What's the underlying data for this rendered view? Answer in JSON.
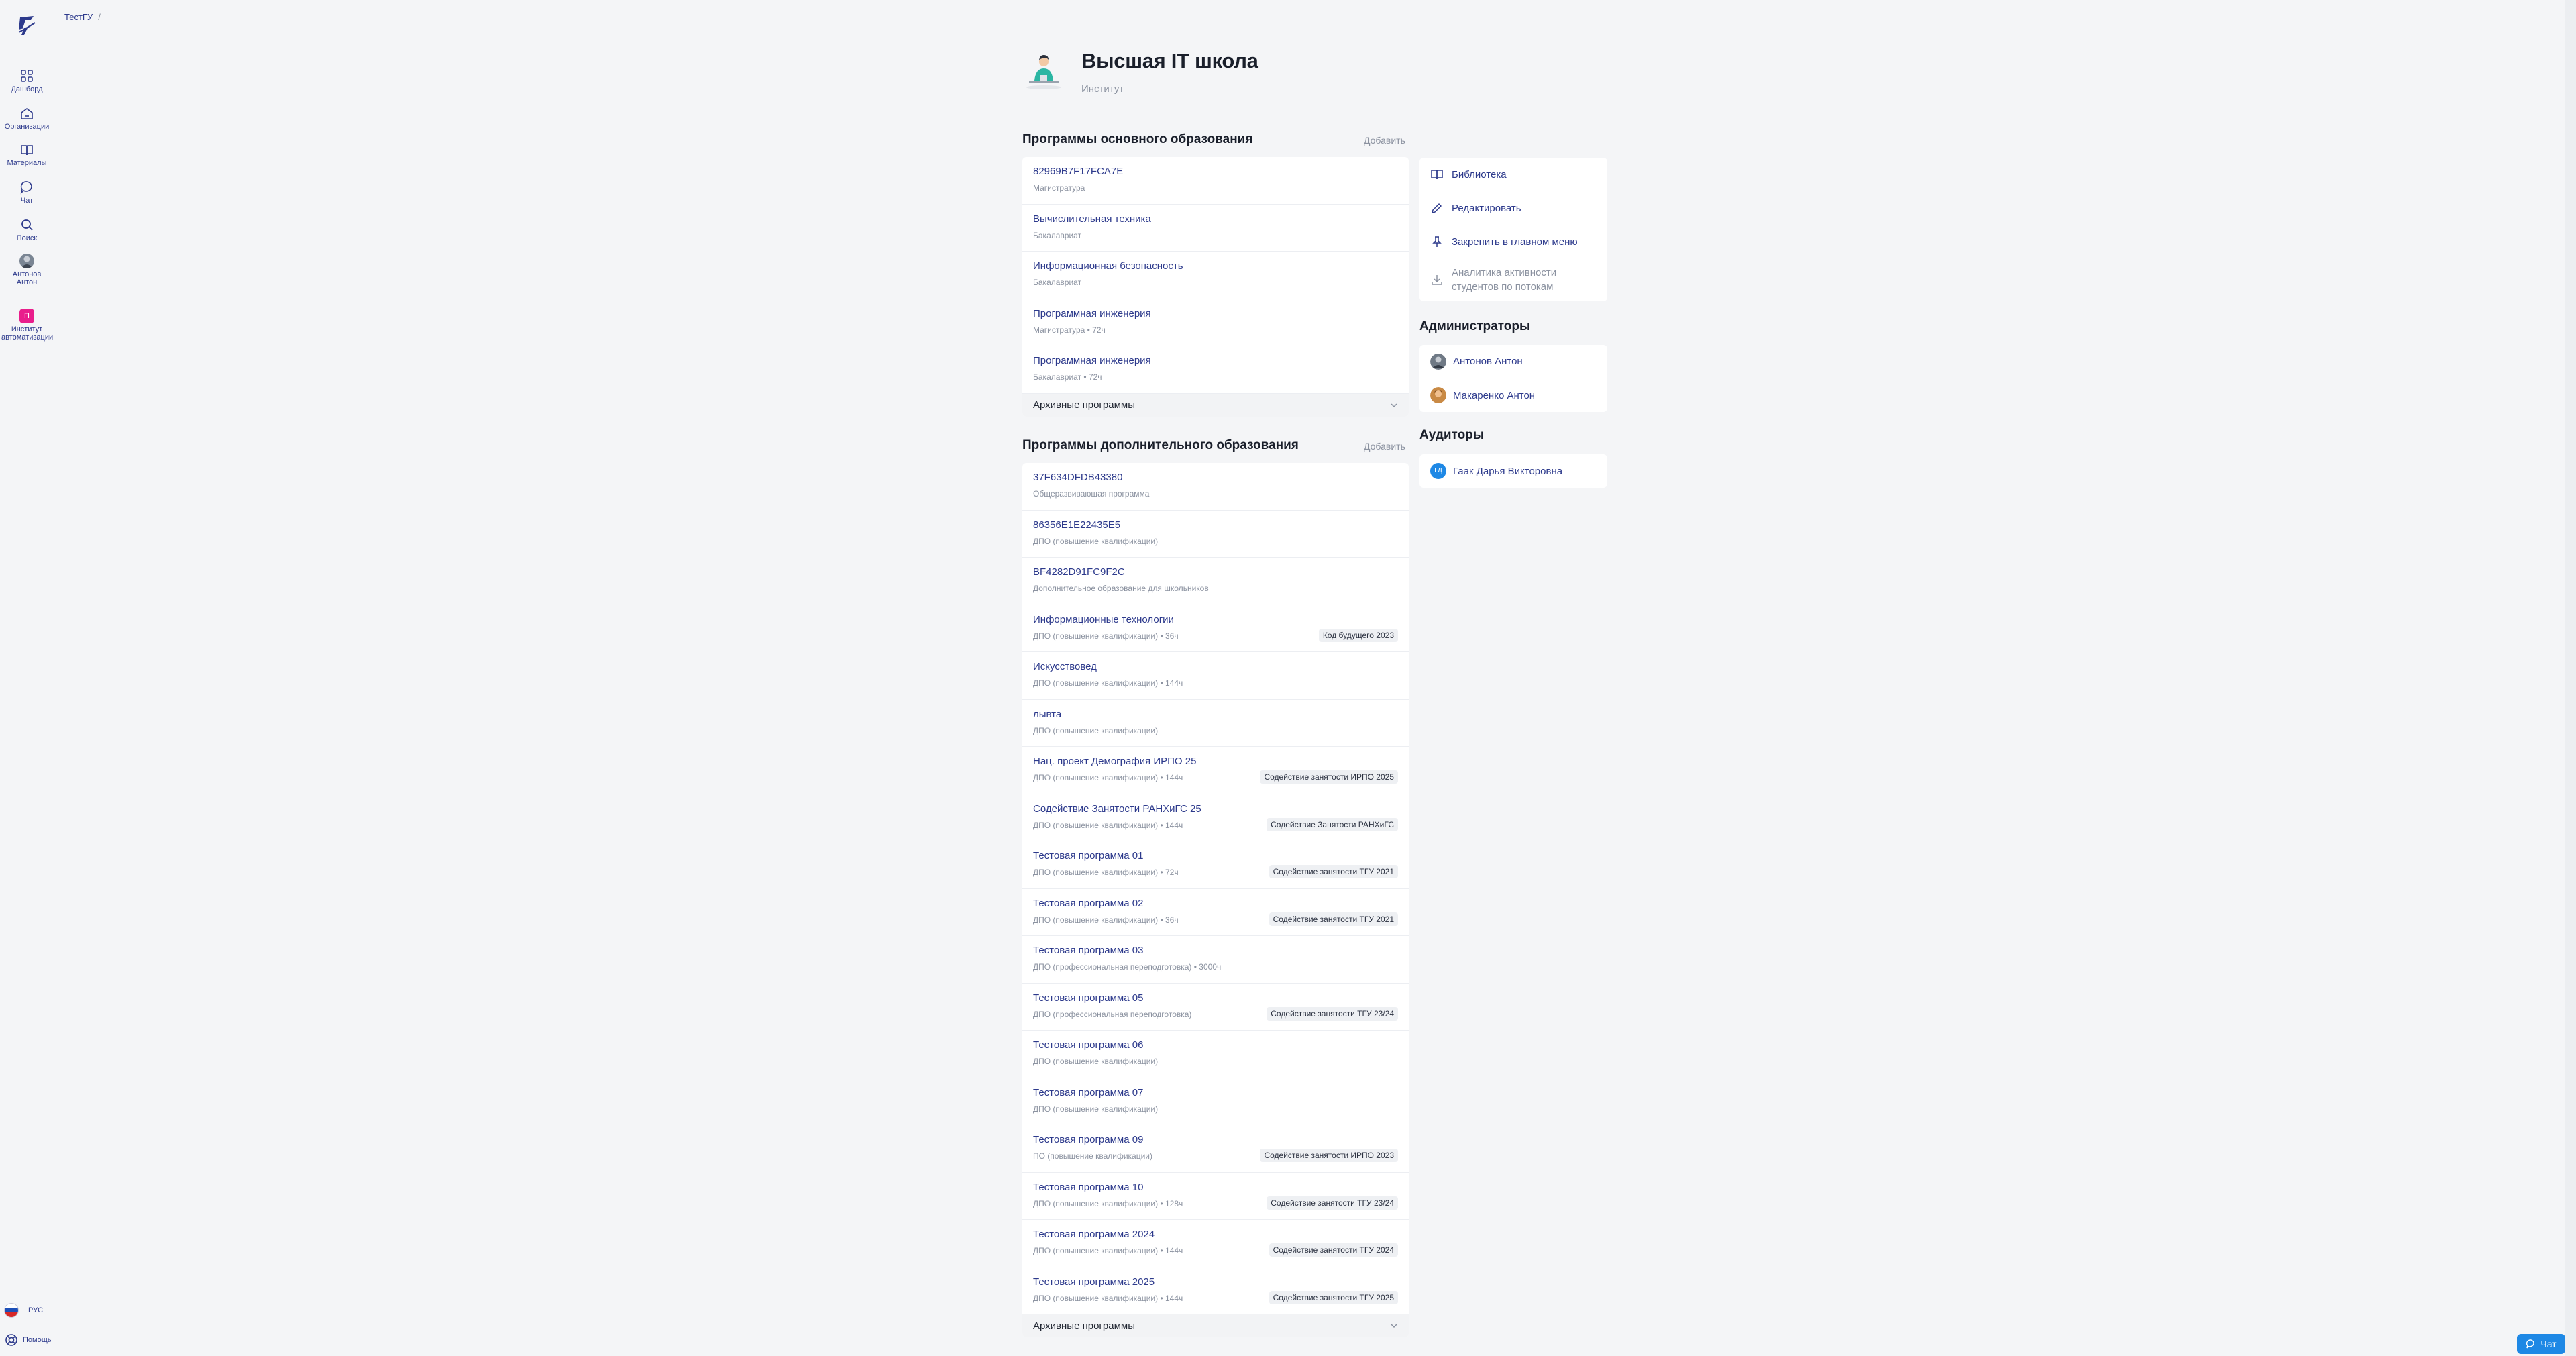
{
  "sidebar": {
    "items": [
      {
        "label": "Дашборд",
        "icon": "dashboard-icon"
      },
      {
        "label": "Организации",
        "icon": "home-icon"
      },
      {
        "label": "Материалы",
        "icon": "book-icon"
      },
      {
        "label": "Чат",
        "icon": "chat-icon"
      },
      {
        "label": "Поиск",
        "icon": "search-icon"
      },
      {
        "label": "Антонов Антон",
        "icon": "avatar"
      },
      {
        "label": "Институт автоматизации",
        "icon": "org-badge",
        "badge": "П"
      }
    ],
    "lang": "РУС",
    "help": "Помощь"
  },
  "breadcrumb": {
    "root": "ТестГУ",
    "sep": "/"
  },
  "header": {
    "title": "Высшая IT школа",
    "subtitle": "Институт"
  },
  "main_programs": {
    "title": "Программы основного образования",
    "add": "Добавить",
    "items": [
      {
        "name": "82969B7F17FCA7E",
        "meta": "Магистратура",
        "tag": ""
      },
      {
        "name": "Вычислительная техника",
        "meta": "Бакалавриат",
        "tag": ""
      },
      {
        "name": "Информационная безопасность",
        "meta": "Бакалавриат",
        "tag": ""
      },
      {
        "name": "Программная инженерия",
        "meta": "Магистратура • 72ч",
        "tag": ""
      },
      {
        "name": "Программная инженерия",
        "meta": "Бакалавриат • 72ч",
        "tag": ""
      }
    ],
    "archive": "Архивные программы"
  },
  "extra_programs": {
    "title": "Программы дополнительного образования",
    "add": "Добавить",
    "items": [
      {
        "name": "37F634DFDB43380",
        "meta": "Общеразвивающая программа",
        "tag": ""
      },
      {
        "name": "86356E1E22435E5",
        "meta": "ДПО (повышение квалификации)",
        "tag": ""
      },
      {
        "name": "BF4282D91FC9F2C",
        "meta": "Дополнительное образование для школьников",
        "tag": ""
      },
      {
        "name": "Информационные технологии",
        "meta": "ДПО (повышение квалификации) • 36ч",
        "tag": "Код будущего 2023"
      },
      {
        "name": "Искусствовед",
        "meta": "ДПО (повышение квалификации) • 144ч",
        "tag": ""
      },
      {
        "name": "лывта",
        "meta": "ДПО (повышение квалификации)",
        "tag": ""
      },
      {
        "name": "Нац. проект Демография ИРПО 25",
        "meta": "ДПО (повышение квалификации) • 144ч",
        "tag": "Содействие занятости ИРПО 2025"
      },
      {
        "name": "Содействие Занятости РАНХиГС 25",
        "meta": "ДПО (повышение квалификации) • 144ч",
        "tag": "Содействие Занятости РАНХиГС"
      },
      {
        "name": "Тестовая программа 01",
        "meta": "ДПО (повышение квалификации) • 72ч",
        "tag": "Содействие занятости ТГУ 2021"
      },
      {
        "name": "Тестовая программа 02",
        "meta": "ДПО (повышение квалификации) • 36ч",
        "tag": "Содействие занятости ТГУ 2021"
      },
      {
        "name": "Тестовая программа 03",
        "meta": "ДПО (профессиональная переподготовка) • 3000ч",
        "tag": ""
      },
      {
        "name": "Тестовая программа 05",
        "meta": "ДПО (профессиональная переподготовка)",
        "tag": "Содействие занятости ТГУ 23/24"
      },
      {
        "name": "Тестовая программа 06",
        "meta": "ДПО (повышение квалификации)",
        "tag": ""
      },
      {
        "name": "Тестовая программа 07",
        "meta": "ДПО (повышение квалификации)",
        "tag": ""
      },
      {
        "name": "Тестовая программа 09",
        "meta": "ПО (повышение квалификации)",
        "tag": "Содействие занятости ИРПО 2023"
      },
      {
        "name": "Тестовая программа 10",
        "meta": "ДПО (повышение квалификации) • 128ч",
        "tag": "Содействие занятости ТГУ 23/24"
      },
      {
        "name": "Тестовая программа 2024",
        "meta": "ДПО (повышение квалификации) • 144ч",
        "tag": "Содействие занятости ТГУ 2024"
      },
      {
        "name": "Тестовая программа 2025",
        "meta": "ДПО (повышение квалификации) • 144ч",
        "tag": "Содействие занятости ТГУ 2025"
      }
    ],
    "archive": "Архивные программы"
  },
  "actions": {
    "library": "Библиотека",
    "edit": "Редактировать",
    "pin": "Закрепить в главном меню",
    "analytics_line1": "Аналитика активности",
    "analytics_line2": "студентов по потокам"
  },
  "admins": {
    "title": "Администраторы",
    "people": [
      "Антонов Антон",
      "Макаренко Антон"
    ]
  },
  "auditors": {
    "title": "Аудиторы",
    "people": [
      {
        "name": "Гаак Дарья Викторовна",
        "initials": "ГД"
      }
    ]
  },
  "chat_button": "Чат",
  "colors": {
    "accent": "#2d3a8c",
    "muted": "#8b92a0",
    "badge": "#e91e8c",
    "chat": "#1e88e5"
  }
}
